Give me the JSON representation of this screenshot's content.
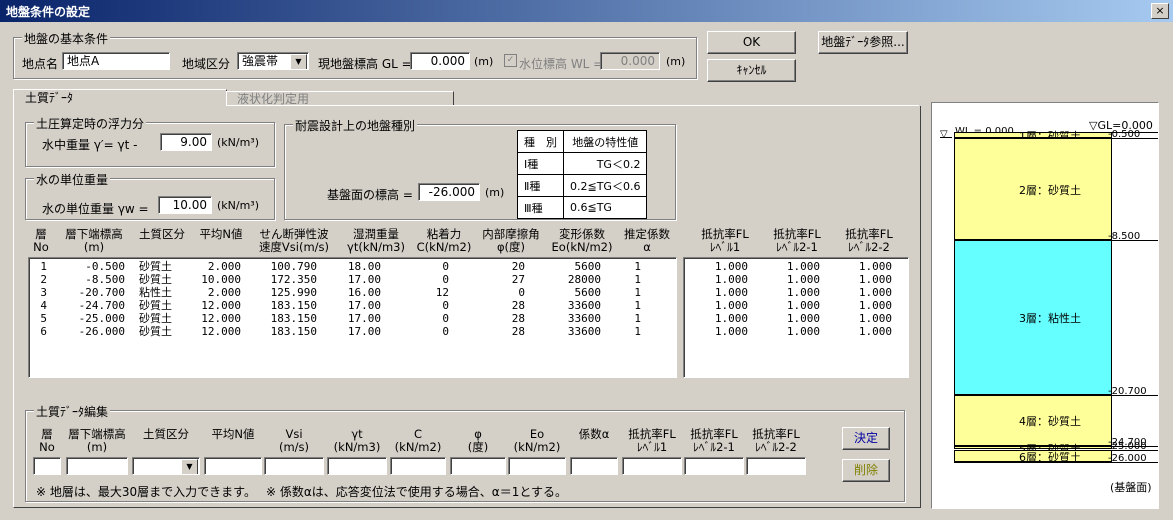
{
  "window": {
    "title": "地盤条件の設定",
    "close": "×"
  },
  "basic": {
    "group_label": "地盤の基本条件",
    "place_label": "地点名",
    "place_value": "地点A",
    "region_label": "地域区分",
    "region_value": "強震帯",
    "gl_label": "現地盤標高 GL =",
    "gl_value": "0.000",
    "gl_unit": "(m)",
    "wl_label": "水位標高 WL =",
    "wl_value": "0.000",
    "wl_unit": "(m)"
  },
  "buttons": {
    "ok": "OK",
    "cancel": "ｷｬﾝｾﾙ",
    "ref": "地盤ﾃﾞｰﾀ参照...",
    "decide": "決定",
    "delete": "削除"
  },
  "tabs": [
    {
      "label": "土質ﾃﾞｰﾀ"
    },
    {
      "label": "液状化判定用"
    }
  ],
  "buoyancy": {
    "group_label": "土圧算定時の浮力分",
    "label": "水中重量 γ′= γt -",
    "value": "9.00",
    "unit": "(kN/m³)"
  },
  "water": {
    "group_label": "水の単位重量",
    "label": "水の単位重量 γw =",
    "value": "10.00",
    "unit": "(kN/m³)"
  },
  "seismic": {
    "group_label": "耐震設計上の地盤種別",
    "base_label": "基盤面の標高 =",
    "base_value": "-26.000",
    "base_unit": "(m)",
    "table_headers": [
      "種　別",
      "地盤の特性値"
    ],
    "table_rows": [
      [
        "Ⅰ種",
        "TG＜0.2"
      ],
      [
        "Ⅱ種",
        "0.2≦TG＜0.6"
      ],
      [
        "Ⅲ種",
        "0.6≦TG"
      ]
    ]
  },
  "soil_table": {
    "headers": [
      [
        "層",
        "No"
      ],
      [
        "層下端標高",
        "(m)"
      ],
      [
        "土質区分",
        ""
      ],
      [
        "平均N値",
        ""
      ],
      [
        "せん断弾性波",
        "速度Vsi(m/s)"
      ],
      [
        "湿潤重量",
        "γt(kN/m3)"
      ],
      [
        "粘着力",
        "C(kN/m2)"
      ],
      [
        "内部摩擦角",
        "φ(度)"
      ],
      [
        "変形係数",
        "Eo(kN/m2)"
      ],
      [
        "推定係数",
        "α"
      ]
    ],
    "fl_headers": [
      [
        "抵抗率FL",
        "ﾚﾍﾞﾙ1"
      ],
      [
        "抵抗率FL",
        "ﾚﾍﾞﾙ2-1"
      ],
      [
        "抵抗率FL",
        "ﾚﾍﾞﾙ2-2"
      ]
    ],
    "rows": [
      [
        "1",
        "-0.500",
        "砂質土",
        "2.000",
        "100.790",
        "18.00",
        "0",
        "20",
        "5600",
        "1"
      ],
      [
        "2",
        "-8.500",
        "砂質土",
        "10.000",
        "172.350",
        "17.00",
        "0",
        "27",
        "28000",
        "1"
      ],
      [
        "3",
        "-20.700",
        "粘性土",
        "2.000",
        "125.990",
        "16.00",
        "12",
        "0",
        "5600",
        "1"
      ],
      [
        "4",
        "-24.700",
        "砂質土",
        "12.000",
        "183.150",
        "17.00",
        "0",
        "28",
        "33600",
        "1"
      ],
      [
        "5",
        "-25.000",
        "砂質土",
        "12.000",
        "183.150",
        "17.00",
        "0",
        "28",
        "33600",
        "1"
      ],
      [
        "6",
        "-26.000",
        "砂質土",
        "12.000",
        "183.150",
        "17.00",
        "0",
        "28",
        "33600",
        "1"
      ]
    ],
    "fl_rows": [
      [
        "1.000",
        "1.000",
        "1.000"
      ],
      [
        "1.000",
        "1.000",
        "1.000"
      ],
      [
        "1.000",
        "1.000",
        "1.000"
      ],
      [
        "1.000",
        "1.000",
        "1.000"
      ],
      [
        "1.000",
        "1.000",
        "1.000"
      ],
      [
        "1.000",
        "1.000",
        "1.000"
      ]
    ]
  },
  "edit": {
    "group_label": "土質ﾃﾞｰﾀ編集",
    "headers": [
      [
        "層",
        "No"
      ],
      [
        "層下端標高",
        "(m)"
      ],
      [
        "土質区分",
        ""
      ],
      [
        "平均N値",
        ""
      ],
      [
        "Vsi",
        "(m/s)"
      ],
      [
        "γt",
        "(kN/m3)"
      ],
      [
        "C",
        "(kN/m2)"
      ],
      [
        "φ",
        "(度)"
      ],
      [
        "Eo",
        "(kN/m2)"
      ],
      [
        "係数α",
        ""
      ],
      [
        "抵抗率FL",
        "ﾚﾍﾞﾙ1"
      ],
      [
        "抵抗率FL",
        "ﾚﾍﾞﾙ2-1"
      ],
      [
        "抵抗率FL",
        "ﾚﾍﾞﾙ2-2"
      ]
    ],
    "note1": "※ 地層は、最大30層まで入力できます。",
    "note2": "※ 係数αは、応答変位法で使用する場合、α＝1とする。"
  },
  "profile": {
    "gl_label": "▽GL=0.000",
    "wl_label": "WL = 0.000",
    "base_label": "(基盤面)",
    "layers": [
      {
        "name": "1層：砂質土",
        "top": 0,
        "bottom": -0.5,
        "color": "#ffff99"
      },
      {
        "name": "2層：砂質土",
        "top": -0.5,
        "bottom": -8.5,
        "color": "#ffff99"
      },
      {
        "name": "3層：粘性土",
        "top": -8.5,
        "bottom": -20.7,
        "color": "#66ffff"
      },
      {
        "name": "4層：砂質土",
        "top": -20.7,
        "bottom": -24.7,
        "color": "#ffff99"
      },
      {
        "name": "5層：砂質土",
        "top": -24.7,
        "bottom": -25.0,
        "color": "#ffff99"
      },
      {
        "name": "6層：砂質土",
        "top": -25.0,
        "bottom": -26.0,
        "color": "#ffff99"
      }
    ],
    "depth_labels": [
      "-0.500",
      "-8.500",
      "-20.700",
      "-24.700",
      "-25.000",
      "-26.000"
    ]
  }
}
